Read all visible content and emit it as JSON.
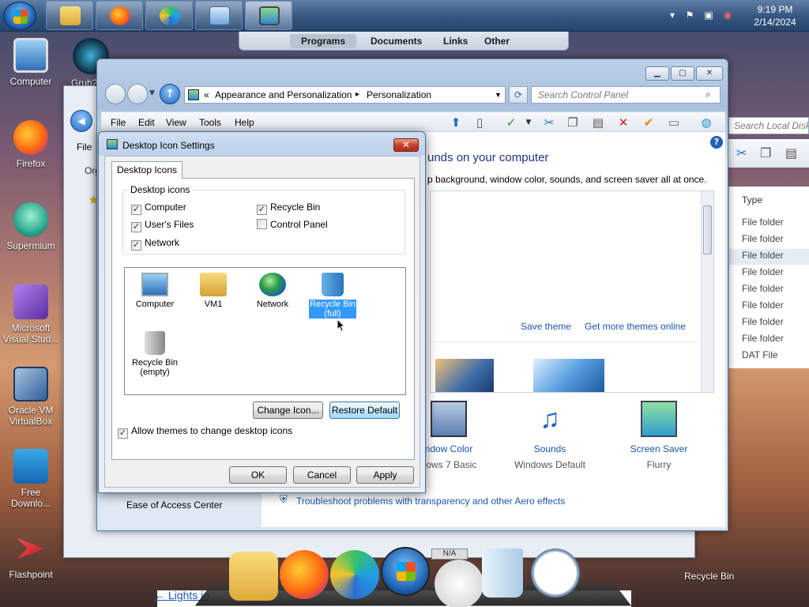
{
  "taskbar": {
    "clock_time": "9:19 PM",
    "clock_date": "2/14/2024",
    "tray_icons": [
      "chevron-up-icon",
      "flag-icon",
      "network-icon",
      "volume-muted-icon"
    ]
  },
  "jumplist": {
    "tabs": [
      {
        "label": "Programs",
        "selected": true
      },
      {
        "label": "Documents",
        "selected": false
      },
      {
        "label": "Links",
        "selected": false
      },
      {
        "label": "Other",
        "selected": false
      }
    ]
  },
  "desktop": {
    "icons": [
      {
        "label": "Computer"
      },
      {
        "label": "Firefox"
      },
      {
        "label": "Supermium"
      },
      {
        "label": "Microsoft Visual Stud..."
      },
      {
        "label": "Oracle VM VirtualBox"
      },
      {
        "label": "Free Downlo..."
      },
      {
        "label": "Flashpoint"
      }
    ],
    "partial_label": "Gruh2...",
    "recycle_bin_label": "Recycle Bin"
  },
  "explorer_back": {
    "menu_file": "File",
    "org_label": "Org",
    "search_placeholder": "Search Local Disk",
    "column_type": "Type",
    "file_types": [
      "File folder",
      "File folder",
      "File folder",
      "File folder",
      "File folder",
      "File folder",
      "File folder",
      "File folder",
      "DAT File"
    ],
    "bottom_link": "← Lights in"
  },
  "control_panel": {
    "breadcrumb_prefix": "«",
    "breadcrumb_1": "Appearance and Personalization",
    "breadcrumb_sep": "▸",
    "breadcrumb_2": "Personalization",
    "search_placeholder": "Search Control Panel",
    "menu": [
      "File",
      "Edit",
      "View",
      "Tools",
      "Help"
    ],
    "heading": "unds on your computer",
    "subheading": "p background, window color, sounds, and screen saver all at once.",
    "save_theme": "Save theme",
    "get_more_themes": "Get more themes online",
    "left_link": "Ease of Access Center",
    "troubleshoot_link": "Troubleshoot problems with transparency and other Aero effects",
    "bottom_items": [
      {
        "title": "ndow Color",
        "subtitle": "dows 7 Basic"
      },
      {
        "title": "Sounds",
        "subtitle": "Windows Default"
      },
      {
        "title": "Screen Saver",
        "subtitle": "Flurry"
      }
    ]
  },
  "dialog": {
    "title": "Desktop Icon Settings",
    "tab": "Desktop Icons",
    "group_title": "Desktop icons",
    "checkboxes": [
      {
        "label": "Computer",
        "checked": true
      },
      {
        "label": "Recycle Bin",
        "checked": true
      },
      {
        "label": "User's Files",
        "checked": true
      },
      {
        "label": "Control Panel",
        "checked": false
      },
      {
        "label": "Network",
        "checked": true
      }
    ],
    "icons": [
      {
        "label": "Computer"
      },
      {
        "label": "VM1"
      },
      {
        "label": "Network"
      },
      {
        "label": "Recycle Bin (full)",
        "selected": true
      },
      {
        "label": "Recycle Bin (empty)"
      }
    ],
    "change_icon": "Change Icon...",
    "restore_default": "Restore Default",
    "allow_themes": "Allow themes to change desktop icons",
    "allow_themes_checked": true,
    "ok": "OK",
    "cancel": "Cancel",
    "apply": "Apply",
    "check_mark": "✓"
  },
  "dock": {
    "badge": "N/A"
  }
}
